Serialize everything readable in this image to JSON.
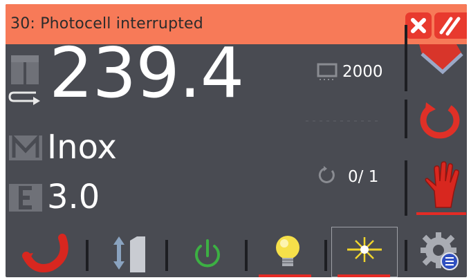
{
  "alarm": {
    "message": "30: Photocell interrupted",
    "color": "#f77a58",
    "button_color": "#e83a2e",
    "close_icon": "close-icon",
    "clear_icon": "clear-all-icon"
  },
  "params": {
    "thickness_value": "239.4",
    "material_value": "Inox",
    "extra_value": "3.0"
  },
  "counters": {
    "piece_count": "2000",
    "cycle_count": "0/ 1"
  },
  "side_buttons": [
    {
      "name": "bend-arrow-icon"
    },
    {
      "name": "rotate-cycle-icon"
    },
    {
      "name": "hand-stop-icon",
      "active": true
    }
  ],
  "toolbar": [
    {
      "name": "return-arrow-icon"
    },
    {
      "name": "up-down-icon"
    },
    {
      "name": "power-icon"
    },
    {
      "name": "lightbulb-icon",
      "active": true
    },
    {
      "name": "laser-icon",
      "active": true,
      "selected": true
    },
    {
      "name": "settings-icon"
    }
  ],
  "colors": {
    "background": "#494b52",
    "accent_red": "#e42b25",
    "power_green": "#3cb043"
  }
}
